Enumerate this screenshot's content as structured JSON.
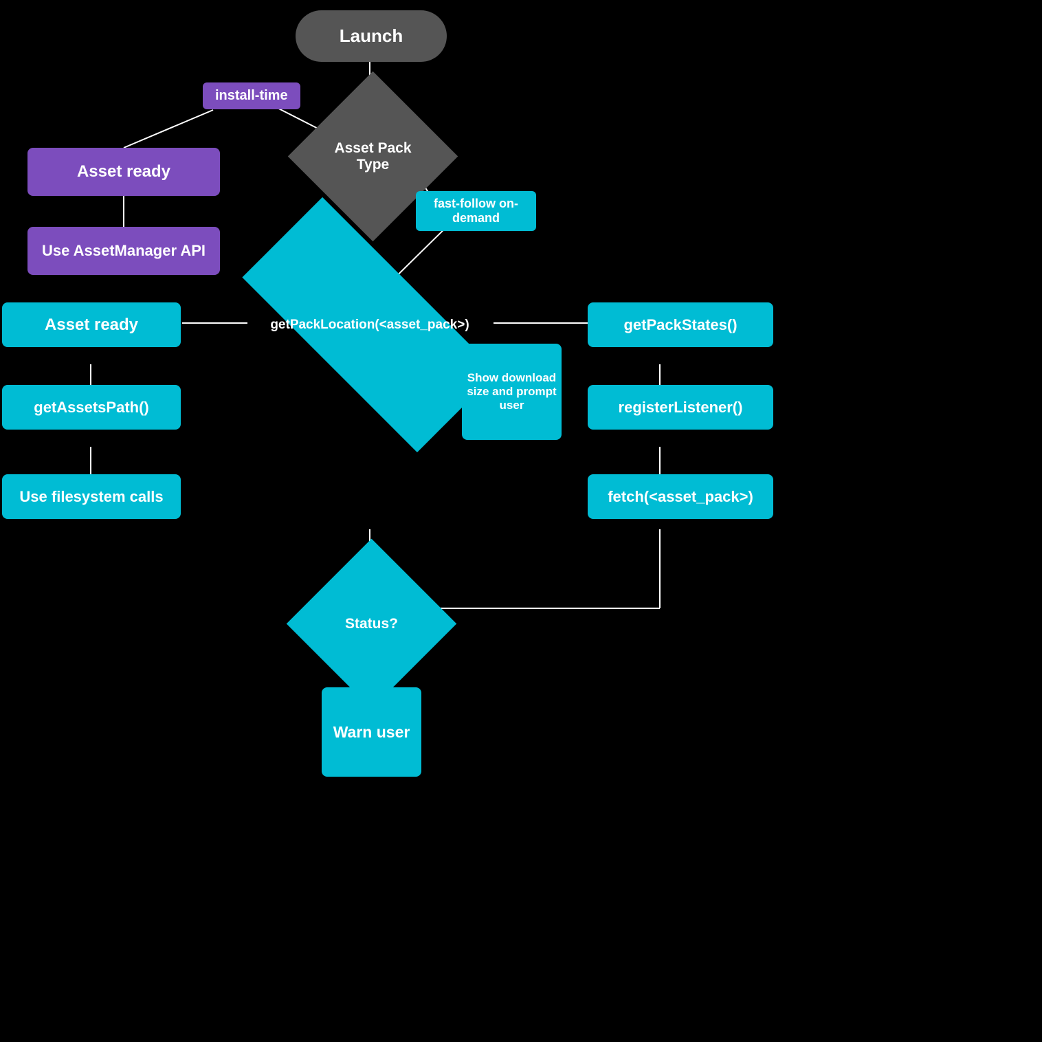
{
  "nodes": {
    "launch": {
      "label": "Launch"
    },
    "assetPackType": {
      "label": "Asset Pack\nType"
    },
    "installTime": {
      "label": "install-time"
    },
    "fastFollow": {
      "label": "fast-follow\non-demand"
    },
    "assetReady1": {
      "label": "Asset ready"
    },
    "useAssetManager": {
      "label": "Use AssetManager API"
    },
    "getPackLocation": {
      "label": "getPackLocation(<asset_pack>)"
    },
    "assetReady2": {
      "label": "Asset ready"
    },
    "getAssetsPath": {
      "label": "getAssetsPath()"
    },
    "useFilesystem": {
      "label": "Use filesystem calls"
    },
    "showDownload": {
      "label": "Show\ndownload\nsize and\nprompt\nuser"
    },
    "getPackStates": {
      "label": "getPackStates()"
    },
    "registerListener": {
      "label": "registerListener()"
    },
    "fetchAssetPack": {
      "label": "fetch(<asset_pack>)"
    },
    "status": {
      "label": "Status?"
    },
    "warnUser": {
      "label": "Warn\nuser"
    }
  }
}
